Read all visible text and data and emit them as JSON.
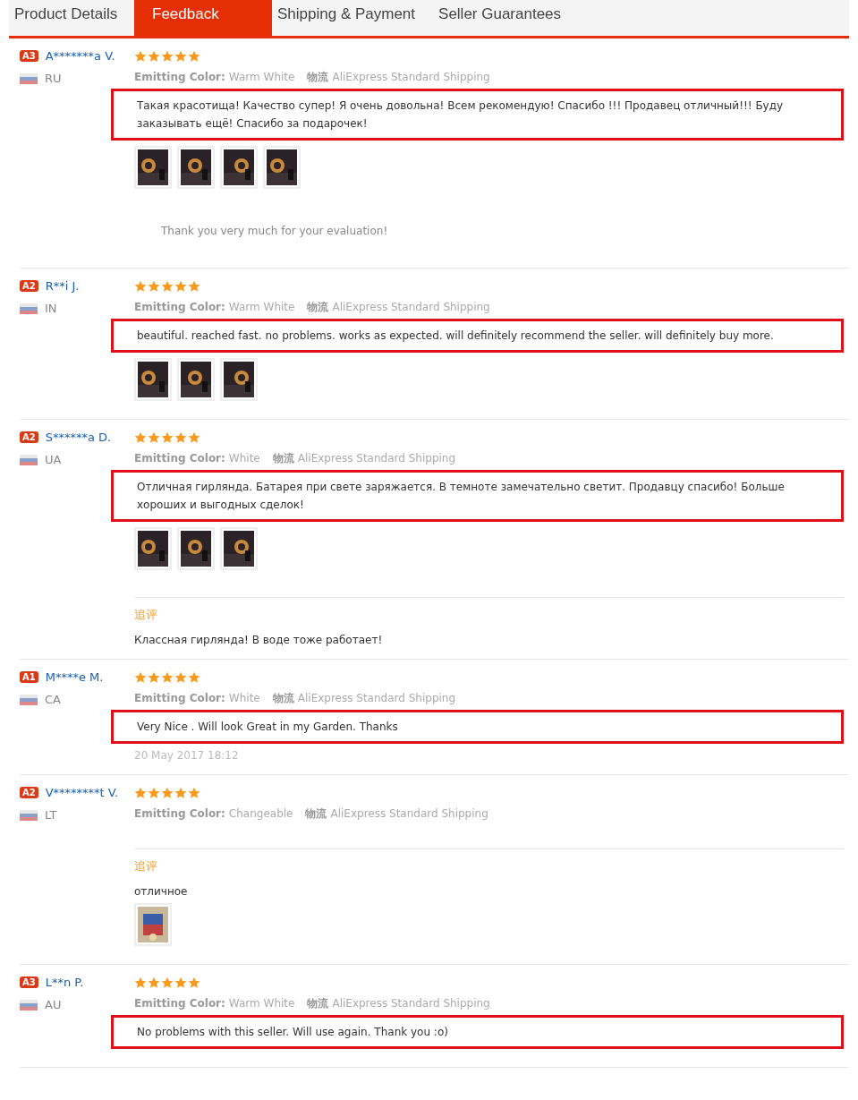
{
  "tabs": [
    {
      "label": "Product Details",
      "selected": false
    },
    {
      "label": "Feedback",
      "selected": true
    },
    {
      "label": "Shipping & Payment",
      "selected": false
    },
    {
      "label": "Seller Guarantees",
      "selected": false
    }
  ],
  "reviews": [
    {
      "badge": "A3",
      "name": "A*******a V.",
      "country": "RU",
      "stars": 5,
      "color_label": "Emitting Color:",
      "color_value": "Warm White",
      "shipping_label": "物流",
      "shipping_value": "AliExpress Standard Shipping",
      "text": "Такая красотища! Качество супер! Я очень довольна! Всем рекомендую! Спасибо !!! Продавец отличный!!! Буду заказывать ещё! Спасибо за подарочек!",
      "highlighted": true,
      "photos": [
        {
          "kind": "picture"
        },
        {
          "kind": "picture"
        },
        {
          "kind": "picture"
        },
        {
          "kind": "picture"
        }
      ],
      "reply": "Thank you very much for your evaluation!"
    },
    {
      "badge": "A2",
      "name": "R**i J.",
      "country": "IN",
      "stars": 5,
      "color_label": "Emitting Color:",
      "color_value": "Warm White",
      "shipping_label": "物流",
      "shipping_value": "AliExpress Standard Shipping",
      "text": "beautiful. reached fast. no problems. works as expected. will definitely recommend the seller. will definitely buy more.",
      "highlighted": true,
      "photos": [
        {
          "kind": "picture"
        },
        {
          "kind": "picture"
        },
        {
          "kind": "picture"
        }
      ]
    },
    {
      "badge": "A2",
      "name": "S******a D.",
      "country": "UA",
      "stars": 5,
      "color_label": "Emitting Color:",
      "color_value": "White",
      "shipping_label": "物流",
      "shipping_value": "AliExpress Standard Shipping",
      "text": "Отличная гирлянда. Батарея при свете заряжается. В темноте замечательно светит. Продавцу спасибо! Больше хороших и выгодных сделок!",
      "highlighted": true,
      "photos": [
        {
          "kind": "picture"
        },
        {
          "kind": "picture"
        },
        {
          "kind": "picture"
        }
      ],
      "followup": {
        "label": "追评",
        "text": "Классная гирлянда! В воде тоже работает!"
      }
    },
    {
      "badge": "A1",
      "name": "M****e M.",
      "country": "CA",
      "stars": 5,
      "color_label": "Emitting Color:",
      "color_value": "White",
      "shipping_label": "物流",
      "shipping_value": "AliExpress Standard Shipping",
      "text": "Very Nice . Will look Great in my Garden. Thanks",
      "highlighted": true,
      "date": "20 May 2017 18:12"
    },
    {
      "badge": "A2",
      "name": "V********t V.",
      "country": "LT",
      "stars": 5,
      "color_label": "Emitting Color:",
      "color_value": "Changeable",
      "shipping_label": "物流",
      "shipping_value": "AliExpress Standard Shipping",
      "followup": {
        "label": "追评",
        "text": "отличное",
        "photos": [
          {
            "kind": "picture"
          }
        ]
      }
    },
    {
      "badge": "A3",
      "name": "L**n P.",
      "country": "AU",
      "stars": 5,
      "color_label": "Emitting Color:",
      "color_value": "Warm White",
      "shipping_label": "物流",
      "shipping_value": "AliExpress Standard Shipping",
      "text": "No problems with this seller. Will use again. Thank you :o)",
      "highlighted": true
    }
  ]
}
